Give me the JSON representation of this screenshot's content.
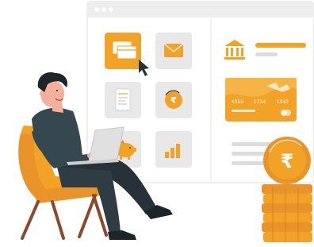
{
  "window": {
    "dots": 3,
    "colors": {
      "frame": "#eaeaea",
      "accent": "#f2a227",
      "tile": "#e6e6e6",
      "line": "#dcdcdc"
    }
  },
  "card": {
    "number_groups": [
      "4356",
      "1234",
      "1942"
    ]
  },
  "icons": {
    "tiles": [
      "cards-icon",
      "mail-icon",
      "receipt-icon",
      "rupee-coin-icon",
      "piggy-bank-icon",
      "bar-chart-icon"
    ],
    "bank": "bank-icon",
    "coin": "rupee-coin-icon"
  },
  "currency_symbol": "₹"
}
